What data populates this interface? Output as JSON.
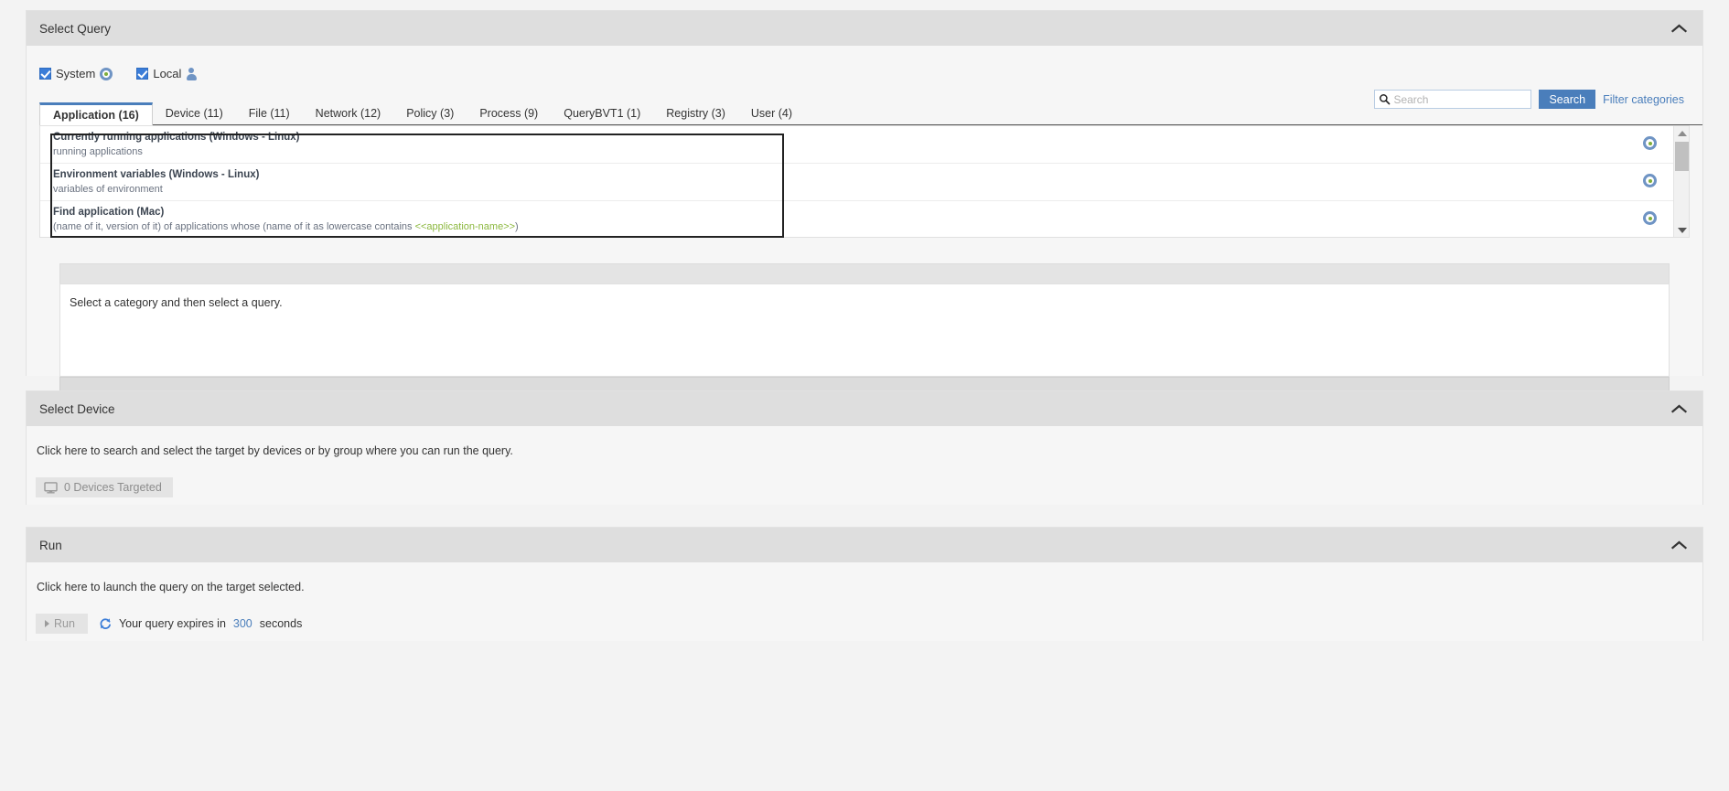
{
  "panels": {
    "query": {
      "title": "Select Query",
      "collapse_icon": "chevron-up-icon"
    },
    "device": {
      "title": "Select Device",
      "collapse_icon": "chevron-up-icon"
    },
    "run": {
      "title": "Run",
      "collapse_icon": "chevron-up-icon"
    }
  },
  "scope_checkboxes": [
    {
      "label": "System",
      "checked": true,
      "icon": "target-icon"
    },
    {
      "label": "Local",
      "checked": true,
      "icon": "person-icon"
    }
  ],
  "search": {
    "placeholder": "Search",
    "value": "",
    "icon": "search-icon",
    "button_label": "Search",
    "filter_link_label": "Filter categories"
  },
  "tabs": [
    {
      "label": "Application (16)",
      "active": true
    },
    {
      "label": "Device (11)",
      "active": false
    },
    {
      "label": "File (11)",
      "active": false
    },
    {
      "label": "Network (12)",
      "active": false
    },
    {
      "label": "Policy (3)",
      "active": false
    },
    {
      "label": "Process (9)",
      "active": false
    },
    {
      "label": "QueryBVT1 (1)",
      "active": false
    },
    {
      "label": "Registry (3)",
      "active": false
    },
    {
      "label": "User (4)",
      "active": false
    }
  ],
  "query_rows": [
    {
      "title": "Currently running applications (Windows - Linux)",
      "desc_prefix": "running applications",
      "desc_placeholder": "",
      "desc_suffix": "",
      "icon": "target-icon"
    },
    {
      "title": "Environment variables (Windows - Linux)",
      "desc_prefix": "variables of environment",
      "desc_placeholder": "",
      "desc_suffix": "",
      "icon": "target-icon"
    },
    {
      "title": "Find application (Mac)",
      "desc_prefix": "(name of it, version of it) of applications whose (name of it as lowercase contains ",
      "desc_placeholder": "<<application-name>>",
      "desc_suffix": ")",
      "icon": "target-icon"
    }
  ],
  "scrollbar": {
    "up_icon": "triangle-up-icon",
    "down_icon": "triangle-down-icon"
  },
  "detail": {
    "message": "Select a category and then select a query."
  },
  "device_section": {
    "instruction": "Click here to search and select the target by devices or by group where you can run the query.",
    "targeted_label": "0 Devices Targeted",
    "targeted_icon": "monitor-icon"
  },
  "run_section": {
    "instruction": "Click here to launch the query on the target selected.",
    "run_button_label": "Run",
    "run_button_icon": "play-icon",
    "refresh_icon": "refresh-icon",
    "expire_prefix": "Your query expires in",
    "expire_seconds": "300",
    "expire_suffix": "seconds"
  },
  "colors": {
    "accent_blue": "#4a7ebb",
    "panel_header_grey": "#dedede",
    "page_bg": "#f3f3f3",
    "placeholder_green": "#8cb83f"
  }
}
